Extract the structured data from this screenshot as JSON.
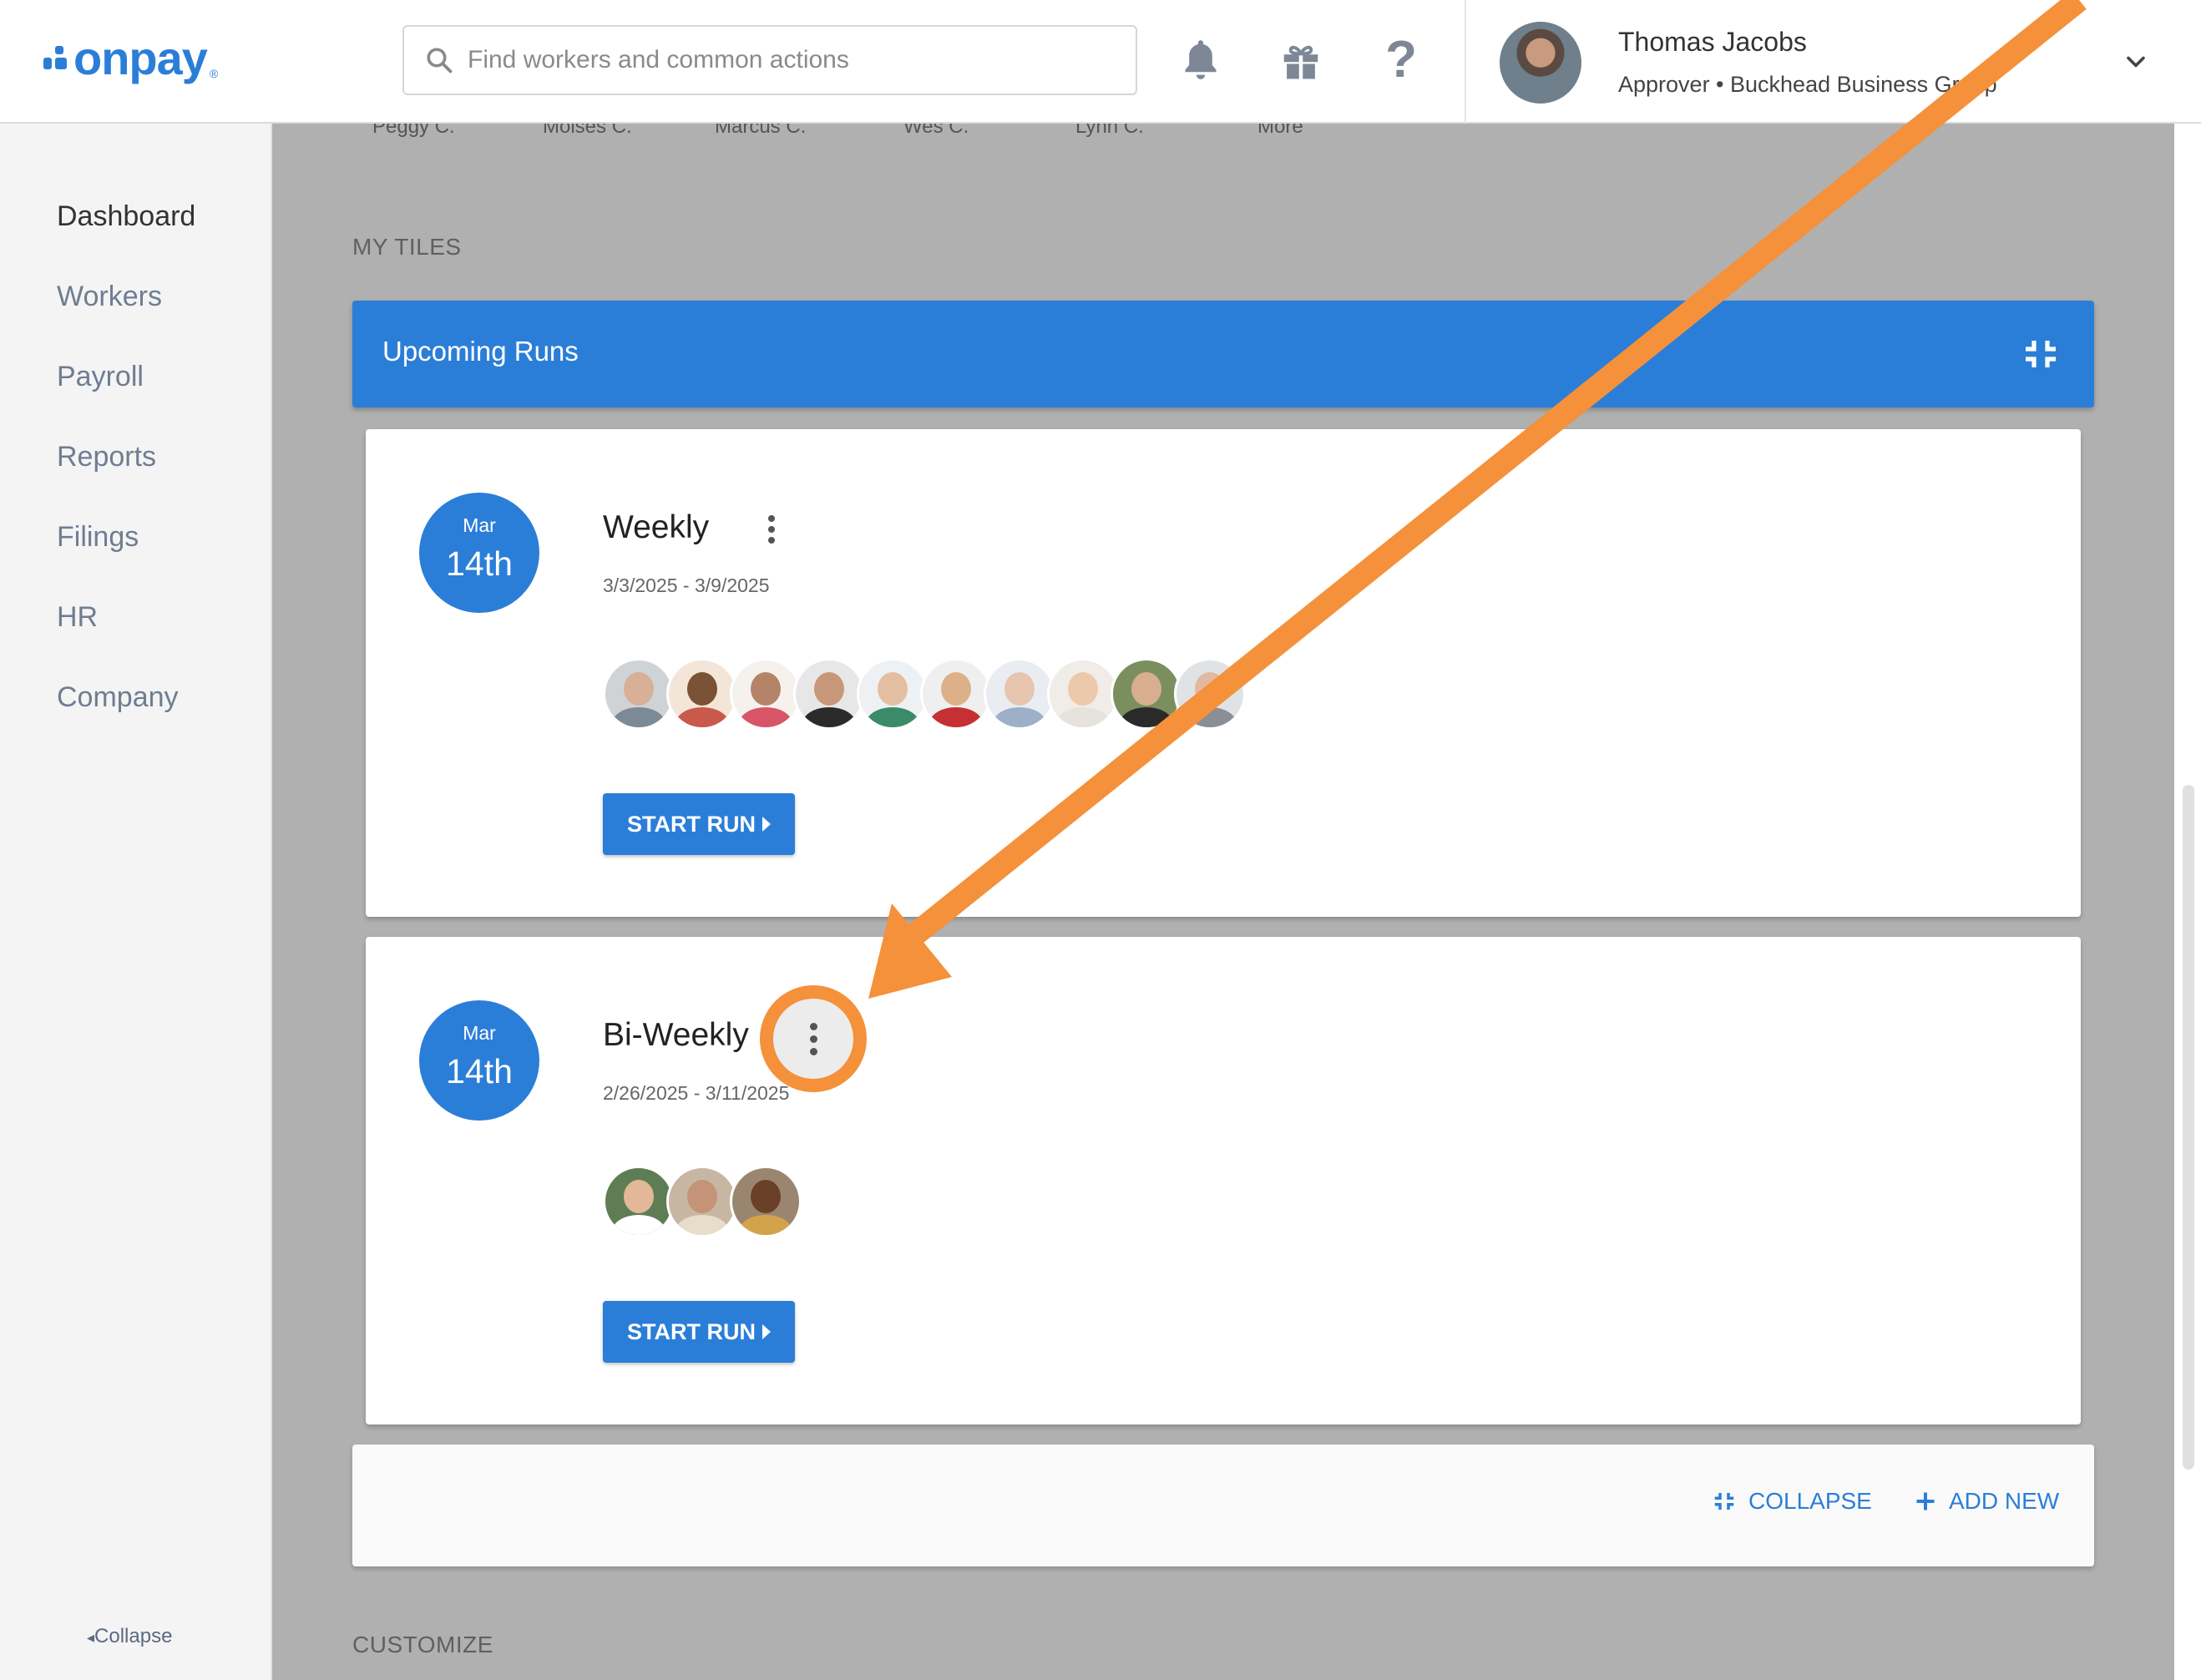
{
  "header": {
    "logo_text": "onpay",
    "logo_reg": "®",
    "search_placeholder": "Find workers and common actions",
    "user": {
      "name": "Thomas Jacobs",
      "role": "Approver • Buckhead Business Group"
    }
  },
  "sidebar": {
    "items": [
      {
        "label": "Dashboard",
        "active": true
      },
      {
        "label": "Workers",
        "active": false
      },
      {
        "label": "Payroll",
        "active": false
      },
      {
        "label": "Reports",
        "active": false
      },
      {
        "label": "Filings",
        "active": false
      },
      {
        "label": "HR",
        "active": false
      },
      {
        "label": "Company",
        "active": false
      }
    ],
    "collapse_label": "Collapse"
  },
  "main": {
    "partial_names": [
      "Peggy C.",
      "Moises C.",
      "Marcus C.",
      "Wes C.",
      "Lynn C.",
      "More"
    ],
    "my_tiles_label": "MY TILES",
    "tile": {
      "title": "Upcoming Runs"
    },
    "runs": [
      {
        "month": "Mar",
        "day": "14th",
        "name": "Weekly",
        "range": "3/3/2025 - 3/9/2025",
        "action": "START RUN"
      },
      {
        "month": "Mar",
        "day": "14th",
        "name": "Bi-Weekly",
        "range": "2/26/2025 - 3/11/2025",
        "action": "START RUN"
      }
    ],
    "footer": {
      "collapse": "COLLAPSE",
      "add_new": "ADD NEW"
    },
    "customize_label": "CUSTOMIZE"
  },
  "colors": {
    "brand": "#2b7ed8",
    "annotation": "#f4913a",
    "overlay": "#b0b0b0"
  }
}
